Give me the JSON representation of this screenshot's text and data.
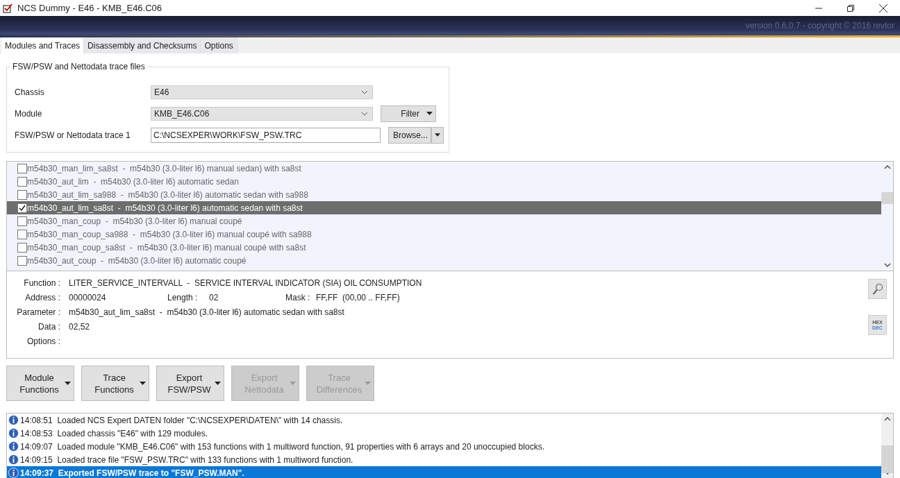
{
  "window": {
    "title": "NCS Dummy - E46 - KMB_E46.C06"
  },
  "banner": {
    "version": "version 0.6.0.7 - copyright © 2016 revtor"
  },
  "tabs": [
    {
      "label": "Modules and Traces",
      "selected": true
    },
    {
      "label": "Disassembly and Checksums",
      "selected": false
    },
    {
      "label": "Options",
      "selected": false
    }
  ],
  "trace_files": {
    "title": "FSW/PSW and Nettodata trace files",
    "chassis": {
      "label": "Chassis",
      "value": "E46"
    },
    "module": {
      "label": "Module",
      "value": "KMB_E46.C06"
    },
    "filter_button": "Filter",
    "trace": {
      "label": "FSW/PSW or Nettodata trace 1",
      "value": "C:\\NCSEXPER\\WORK\\FSW_PSW.TRC"
    },
    "browse_button": "Browse..."
  },
  "parameters": [
    {
      "label": "m54b30_man_lim_sa8st  -  m54b30 (3.0-liter l6) manual sedan) with sa8st",
      "checked": false,
      "selected": false
    },
    {
      "label": "m54b30_aut_lim  -  m54b30 (3.0-liter l6) automatic sedan",
      "checked": false,
      "selected": false
    },
    {
      "label": "m54b30_aut_lim_sa988  -  m54b30 (3.0-liter l6) automatic sedan with sa988",
      "checked": false,
      "selected": false
    },
    {
      "label": "m54b30_aut_lim_sa8st  -  m54b30 (3.0-liter l6) automatic sedan with sa8st",
      "checked": true,
      "selected": true
    },
    {
      "label": "m54b30_man_coup  -  m54b30 (3.0-liter l6) manual coupé",
      "checked": false,
      "selected": false
    },
    {
      "label": "m54b30_man_coup_sa988  -  m54b30 (3.0-liter l6) manual coupé with sa988",
      "checked": false,
      "selected": false
    },
    {
      "label": "m54b30_man_coup_sa8st  -  m54b30 (3.0-liter l6) manual coupé with sa8st",
      "checked": false,
      "selected": false
    },
    {
      "label": "m54b30_aut_coup  -  m54b30 (3.0-liter l6) automatic coupé",
      "checked": false,
      "selected": false
    }
  ],
  "details": {
    "function": {
      "label": "Function :",
      "value": "LITER_SERVICE_INTERVALL  -  SERVICE INTERVAL INDICATOR (SIA) OIL CONSUMPTION"
    },
    "address": {
      "label": "Address :",
      "value": "00000024"
    },
    "length": {
      "label": "Length :",
      "value": "02"
    },
    "mask": {
      "label": "Mask :",
      "value": "FF,FF  (00,00 .. FF,FF)"
    },
    "parameter": {
      "label": "Parameter :",
      "value": "m54b30_aut_lim_sa8st  -  m54b30 (3.0-liter l6) automatic sedan with sa8st"
    },
    "data": {
      "label": "Data :",
      "value": "02,52"
    },
    "options": {
      "label": "Options :"
    },
    "hex_dec": {
      "top": "HEX",
      "bottom": "DEC"
    }
  },
  "actions": [
    {
      "line1": "Module",
      "line2": "Functions",
      "disabled": false
    },
    {
      "line1": "Trace",
      "line2": "Functions",
      "disabled": false
    },
    {
      "line1": "Export",
      "line2": "FSW/PSW",
      "disabled": false
    },
    {
      "line1": "Export",
      "line2": "Nettodata",
      "disabled": true
    },
    {
      "line1": "Trace",
      "line2": "Differences",
      "disabled": true
    }
  ],
  "log": [
    {
      "time": "14:08:51",
      "message": "Loaded NCS Expert DATEN folder \"C:\\NCSEXPER\\DATEN\\\" with 14 chassis.",
      "selected": false
    },
    {
      "time": "14:08:53",
      "message": "Loaded chassis \"E46\" with 129 modules.",
      "selected": false
    },
    {
      "time": "14:09:07",
      "message": "Loaded module \"KMB_E46.C06\" with 153 functions with 1 multiword function, 91 properties with 6 arrays and 20 unoccupied blocks.",
      "selected": false
    },
    {
      "time": "14:09:15",
      "message": "Loaded trace file \"FSW_PSW.TRC\" with 133 functions with 1 multiword function.",
      "selected": false
    },
    {
      "time": "14:09:37",
      "message": "Exported FSW/PSW trace to \"FSW_PSW.MAN\".",
      "selected": true
    }
  ]
}
